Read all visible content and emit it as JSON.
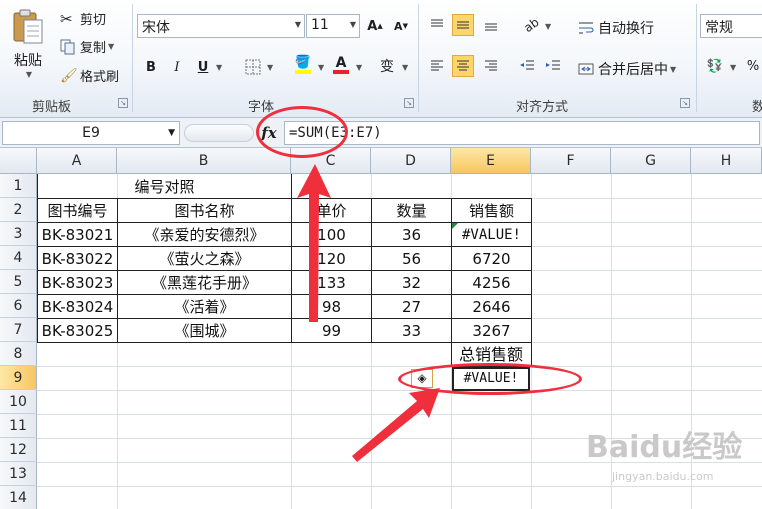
{
  "ribbon": {
    "clipboard": {
      "paste": "粘贴",
      "cut": "剪切",
      "copy": "复制",
      "format_painter": "格式刷",
      "group": "剪贴板"
    },
    "font": {
      "name": "宋体",
      "size": "11",
      "bold": "B",
      "italic": "I",
      "underline": "U",
      "wen": "变",
      "group": "字体"
    },
    "alignment": {
      "wrap_text": "自动换行",
      "merge_center": "合并后居中",
      "group": "对齐方式"
    },
    "number": {
      "format": "常规",
      "percent": "%",
      "group_partial": "数"
    }
  },
  "formula_bar": {
    "name_box": "E9",
    "fx": "fx",
    "formula": "=SUM(E3:E7)"
  },
  "columns": [
    "A",
    "B",
    "C",
    "D",
    "E",
    "F",
    "G",
    "H"
  ],
  "rows": [
    "1",
    "2",
    "3",
    "4",
    "5",
    "6",
    "7",
    "8",
    "9",
    "10",
    "11",
    "12",
    "13",
    "14"
  ],
  "sheet": {
    "title": "编号对照",
    "headers": [
      "图书编号",
      "图书名称",
      "单价",
      "数量",
      "销售额"
    ],
    "records": [
      [
        "BK-83021",
        "《亲爱的安德烈》",
        "100",
        "36",
        "#VALUE!"
      ],
      [
        "BK-83022",
        "《萤火之森》",
        "120",
        "56",
        "6720"
      ],
      [
        "BK-83023",
        "《黑莲花手册》",
        "133",
        "32",
        "4256"
      ],
      [
        "BK-83024",
        "《活着》",
        "98",
        "27",
        "2646"
      ],
      [
        "BK-83025",
        "《围城》",
        "99",
        "33",
        "3267"
      ]
    ],
    "total_label": "总销售额",
    "total_value": "#VALUE!"
  },
  "watermark": {
    "main": "Baidu经验",
    "sub": "jingyan.baidu.com"
  },
  "colors": {
    "annotation": "#ef2f3c",
    "selection": "#f7c660"
  }
}
